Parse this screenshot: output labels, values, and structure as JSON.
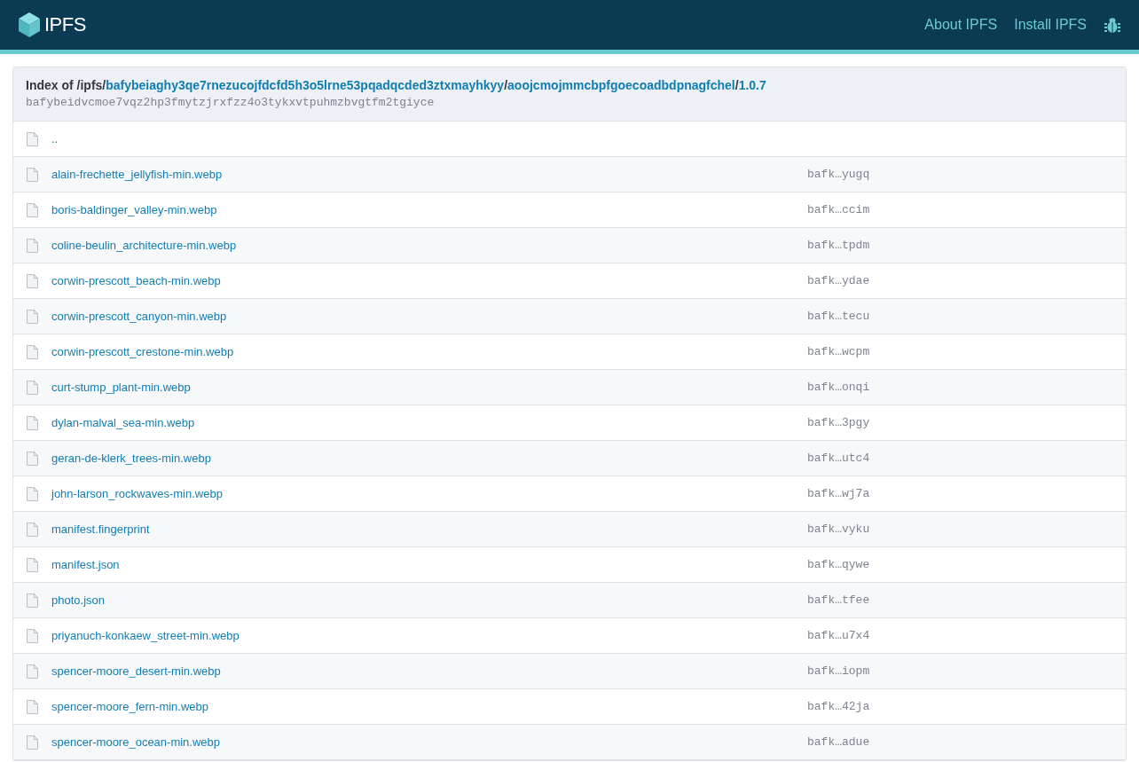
{
  "header": {
    "logo_text": "IPFS",
    "nav": [
      "About IPFS",
      "Install IPFS"
    ]
  },
  "index": {
    "path": [
      {
        "kind": "plain",
        "text": "Index of /ipfs/"
      },
      {
        "kind": "link",
        "text": "bafybeiaghy3qe7rnezucojfdcfd5h3o5lrne53pqadqcded3ztxmayhkyy"
      },
      {
        "kind": "plain",
        "text": "/"
      },
      {
        "kind": "link",
        "text": "aoojcmojmmcbpfgoecoadbdpnagfchel"
      },
      {
        "kind": "plain",
        "text": "/"
      },
      {
        "kind": "link",
        "text": "1.0.7"
      }
    ],
    "cid": "bafybeidvcmoe7vqz2hp3fmytzjrxfzz4o3tykxvtpuhmzbvgtfm2tgiyce"
  },
  "rows": [
    {
      "name": ".."
    },
    {
      "name": "alain-frechette_jellyfish-min.webp",
      "hash": "bafk…yugq"
    },
    {
      "name": "boris-baldinger_valley-min.webp",
      "hash": "bafk…ccim"
    },
    {
      "name": "coline-beulin_architecture-min.webp",
      "hash": "bafk…tpdm"
    },
    {
      "name": "corwin-prescott_beach-min.webp",
      "hash": "bafk…ydae"
    },
    {
      "name": "corwin-prescott_canyon-min.webp",
      "hash": "bafk…tecu"
    },
    {
      "name": "corwin-prescott_crestone-min.webp",
      "hash": "bafk…wcpm"
    },
    {
      "name": "curt-stump_plant-min.webp",
      "hash": "bafk…onqi"
    },
    {
      "name": "dylan-malval_sea-min.webp",
      "hash": "bafk…3pgy"
    },
    {
      "name": "geran-de-klerk_trees-min.webp",
      "hash": "bafk…utc4"
    },
    {
      "name": "john-larson_rockwaves-min.webp",
      "hash": "bafk…wj7a"
    },
    {
      "name": "manifest.fingerprint",
      "hash": "bafk…vyku"
    },
    {
      "name": "manifest.json",
      "hash": "bafk…qywe"
    },
    {
      "name": "photo.json",
      "hash": "bafk…tfee"
    },
    {
      "name": "priyanuch-konkaew_street-min.webp",
      "hash": "bafk…u7x4"
    },
    {
      "name": "spencer-moore_desert-min.webp",
      "hash": "bafk…iopm"
    },
    {
      "name": "spencer-moore_fern-min.webp",
      "hash": "bafk…42ja"
    },
    {
      "name": "spencer-moore_ocean-min.webp",
      "hash": "bafk…adue"
    }
  ]
}
